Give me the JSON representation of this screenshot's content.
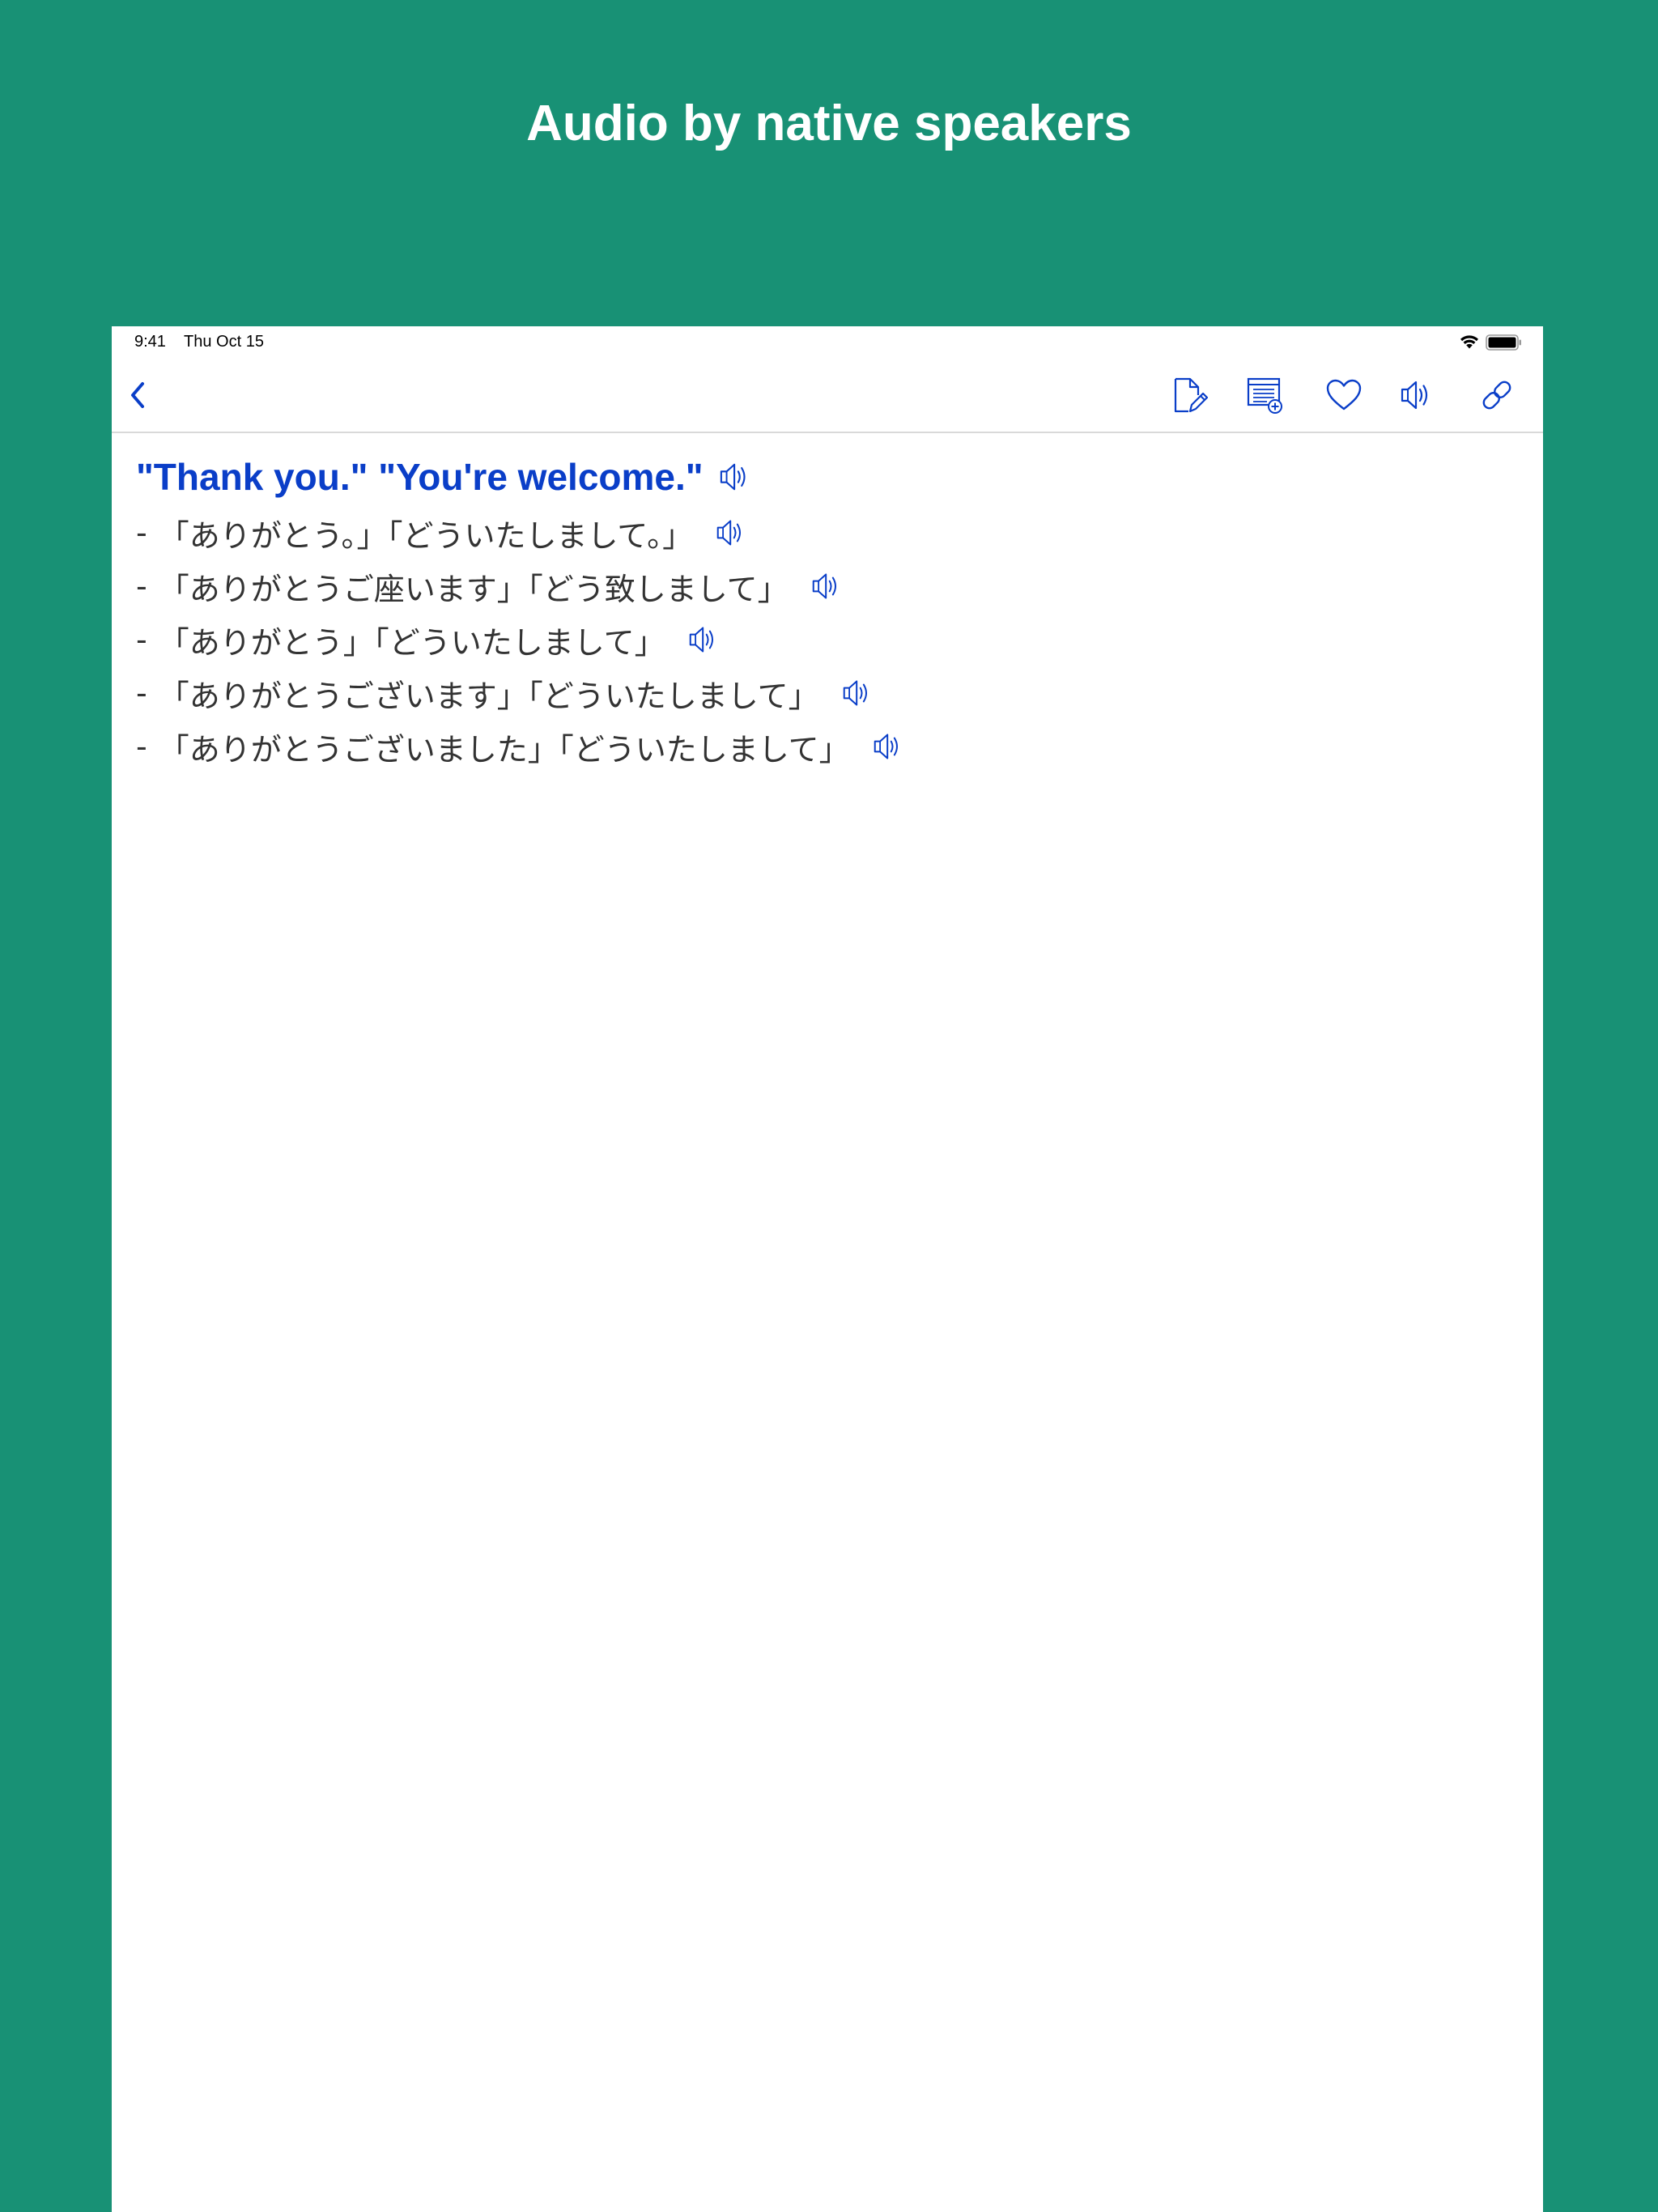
{
  "promo": {
    "headline": "Audio by native speakers"
  },
  "status_bar": {
    "time": "9:41",
    "date": "Thu Oct 15",
    "icons": [
      "wifi-icon",
      "battery-icon"
    ]
  },
  "nav_bar": {
    "left_icon": "chevron-left-icon",
    "right_icons": [
      "edit-note-icon",
      "add-to-list-icon",
      "heart-icon",
      "speaker-icon",
      "link-icon"
    ]
  },
  "phrase": {
    "title": "\"Thank you.\" \"You're welcome.\"",
    "variants": [
      {
        "dash": "-",
        "text": "「ありがとう。」「どういたしまして。」"
      },
      {
        "dash": "-",
        "text": "「ありがとうご座います」「どう致しまして」"
      },
      {
        "dash": "-",
        "text": "「ありがとう」「どういたしまして」"
      },
      {
        "dash": "-",
        "text": "「ありがとうございます」「どういたしまして」"
      },
      {
        "dash": "-",
        "text": "「ありがとうございました」「どういたしまして」"
      }
    ]
  },
  "colors": {
    "background": "#189175",
    "accent": "#0a3ec8",
    "body_text": "#333333"
  }
}
